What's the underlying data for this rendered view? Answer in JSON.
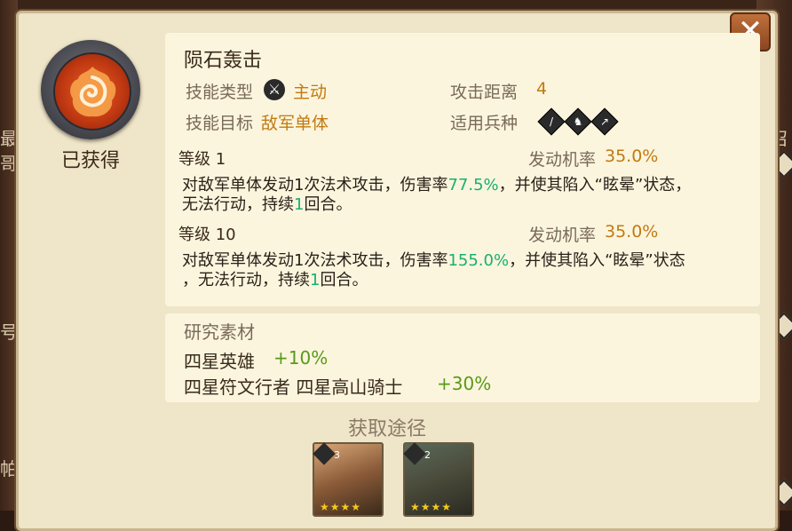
{
  "background": {
    "left_chars": [
      "最",
      "哥",
      "号",
      "帕"
    ],
    "right_chars": [
      "召"
    ]
  },
  "skill": {
    "name": "陨石轰击",
    "status": "已获得",
    "type_label": "技能类型",
    "type_value": "主动",
    "target_label": "技能目标",
    "target_value": "敌军单体",
    "range_label": "攻击距离",
    "range_value": "4",
    "troops_label": "适用兵种"
  },
  "levels": [
    {
      "level_label": "等级",
      "level_value": "1",
      "chance_label": "发动机率",
      "chance_value": "35.0%",
      "desc_a": "对敌军单体发动1次法术攻击，伤害率",
      "desc_rate": "77.5%",
      "desc_b": "，并使其陷入“眩晕”状态，",
      "desc_c": "无法行动，持续",
      "desc_turns": "1",
      "desc_d": "回合。"
    },
    {
      "level_label": "等级",
      "level_value": "10",
      "chance_label": "发动机率",
      "chance_value": "35.0%",
      "desc_a": "对敌军单体发动1次法术攻击，伤害率",
      "desc_rate": "155.0%",
      "desc_b": "，并使其陷入“眩晕”状态",
      "desc_c": "，无法行动，持续",
      "desc_turns": "1",
      "desc_d": "回合。"
    }
  ],
  "material": {
    "title": "研究素材",
    "rows": [
      {
        "text": "四星英雄",
        "bonus": "+10%"
      },
      {
        "text": "四星符文行者 四星高山骑士",
        "bonus": "+30%"
      }
    ]
  },
  "source": {
    "title": "获取途径",
    "heroes": [
      {
        "level": "3",
        "stars": "★★★★"
      },
      {
        "level": "2",
        "stars": "★★★★"
      }
    ]
  },
  "icons": {
    "close": "close-icon",
    "skill": "meteor-fire-icon",
    "type": "sword-slash-icon",
    "troops": [
      "sword-troop-icon",
      "cavalry-troop-icon",
      "archer-troop-icon"
    ]
  },
  "colors": {
    "orange": "#c27a10",
    "green": "#18b070",
    "bonus": "#5a9a18"
  }
}
